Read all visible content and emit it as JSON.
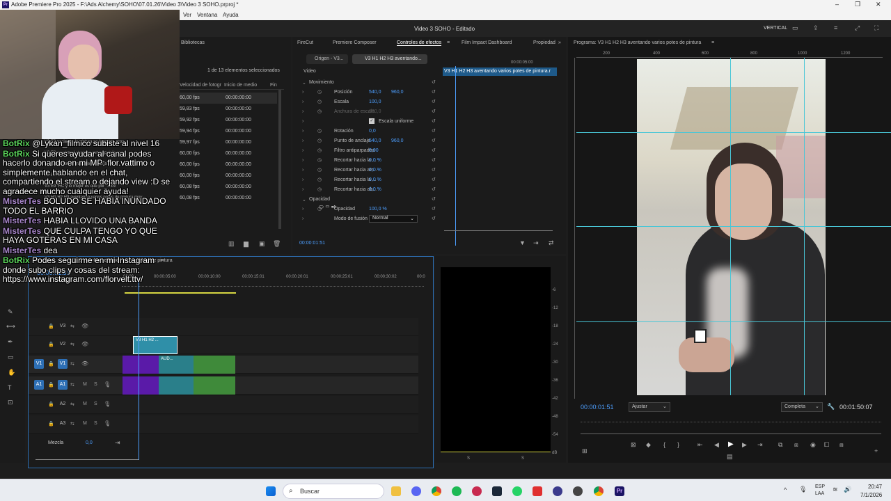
{
  "window": {
    "title": "Adobe Premiere Pro 2025 - F:\\Ads Alchemy\\SOHO\\07.01.26\\Video 3\\Video 3 SOHO.prproj *",
    "controls": [
      "–",
      "❐",
      "✕"
    ]
  },
  "menu": {
    "items": [
      "Ver",
      "Ventana",
      "Ayuda"
    ]
  },
  "appbar": {
    "project_title": "Video 3 SOHO - Editado",
    "vertical_label": "VERTICAL"
  },
  "project": {
    "tab": "Bibliotecas",
    "selection": "1 de 13 elementos seleccionados",
    "col_fps": "Velocidad de fotogr",
    "col_start": "Inicio de medio",
    "col_end": "Fin",
    "rows": [
      {
        "name": "",
        "fps": "60,00 fps",
        "start": "00:00:00:00"
      },
      {
        "name": "",
        "fps": "59,83 fps",
        "start": "00:00:00:00"
      },
      {
        "name": "",
        "fps": "59,92 fps",
        "start": "00:00:00:00"
      },
      {
        "name": "",
        "fps": "59,94 fps",
        "start": "00:00:00:00"
      },
      {
        "name": "V3 E3 vaciando la pintura en la paleta.mov",
        "fps": "59,97 fps",
        "start": "00:00:00:00"
      },
      {
        "name": "V3 E2 mostrando textura con espatula.mov",
        "fps": "60,00 fps",
        "start": "00:00:00:00"
      },
      {
        "name": "V3 E4 haciendo trazos en el lienzo.mov",
        "fps": "60,00 fps",
        "start": "00:00:00:00"
      },
      {
        "name": "V3 E5 ...",
        "fps": "60,00 fps",
        "start": "00:00:00:00"
      },
      {
        "name": "V3 E9_HC y lo mejor es que por_.mov",
        "fps": "60,08 fps",
        "start": "00:00:00:00"
      },
      {
        "name": "V3 H1 H2 H3 aventando varios potes de pintura.mov",
        "fps": "60,08 fps",
        "start": "00:00:00:00"
      }
    ]
  },
  "effects": {
    "tabs": [
      "FireCut",
      "Premiere Composer",
      "Controles de efectos",
      "Film Impact Dashboard",
      "Propiedad"
    ],
    "source_tab": "Origen - V3...",
    "clip_tab": "V3 H1 H2 H3 aventando...",
    "ruler_time": "00:00:05:00",
    "clip_label": "V3 H1 H2 H3 aventando varios potes de pintura.r",
    "section_video": "Video",
    "rows": [
      {
        "label": "Movimiento",
        "v1": "",
        "v2": ""
      },
      {
        "label": "Posición",
        "v1": "540,0",
        "v2": "960,0"
      },
      {
        "label": "Escala",
        "v1": "100,0",
        "v2": ""
      },
      {
        "label": "Anchura de escala",
        "v1": "100,0",
        "v2": ""
      },
      {
        "label": "Escala uniforme",
        "v1": "",
        "v2": ""
      },
      {
        "label": "Rotación",
        "v1": "0,0",
        "v2": ""
      },
      {
        "label": "Punto de anclaje",
        "v1": "540,0",
        "v2": "960,0"
      },
      {
        "label": "Filtro antiparpadeo",
        "v1": "0,00",
        "v2": ""
      },
      {
        "label": "Recortar hacia la ...",
        "v1": "0,0 %",
        "v2": ""
      },
      {
        "label": "Recortar hacia arr...",
        "v1": "0,0 %",
        "v2": ""
      },
      {
        "label": "Recortar hacia la ...",
        "v1": "0,0 %",
        "v2": ""
      },
      {
        "label": "Recortar hacia ab...",
        "v1": "0,0 %",
        "v2": ""
      },
      {
        "label": "Opacidad",
        "v1": "",
        "v2": ""
      },
      {
        "label": "Opacidad",
        "v1": "100,0 %",
        "v2": ""
      },
      {
        "label": "Modo de fusión",
        "v1": "Normal",
        "v2": ""
      }
    ],
    "timecode": "00:00:01:51"
  },
  "program": {
    "title": "Programa: V3 H1 H2 H3 aventando varios potes de pintura",
    "ruler": [
      "200",
      "400",
      "600",
      "800",
      "1000",
      "1200"
    ],
    "timecode": "00:00:01:51",
    "fit": "Ajustar",
    "quality": "Completa",
    "duration": "00:01:50:07"
  },
  "timeline": {
    "seq_name": "V3 H1 H2 H3 aventando varios potes de pintura",
    "timecode": "00:00:01:51",
    "ruler": [
      "00:00",
      "00:00:05:00",
      "00:00:10:00",
      "00:00:15:01",
      "00:00:20:01",
      "00:00:25:01",
      "00:00:30:02",
      "00:0"
    ],
    "tracks": [
      "V3",
      "V2",
      "V1",
      "A1",
      "A2",
      "A3"
    ],
    "mix_label": "Mezcla",
    "mix_value": "0,0",
    "clip_v2": "V3 H1 H2 ...",
    "clip_aud": "AUD..."
  },
  "meter": {
    "db": [
      "-6",
      "-12",
      "-18",
      "-24",
      "-30",
      "-36",
      "-42",
      "-48",
      "-54",
      "dB"
    ],
    "s1": "S",
    "s2": "S"
  },
  "chat": [
    {
      "user": "BotRix",
      "color": "#5cd65c",
      "msg": "@Lykan_filmico subiste al nivel 16"
    },
    {
      "user": "BotRix",
      "color": "#5cd65c",
      "msg": "Si queres ayudar al canal podes hacerlo donando en mi MP: flor.vattimo o simplemente hablando en el chat, compartiendo el stream o dejando view :D se agradece mucho cualquier ayuda!"
    },
    {
      "user": "MisterTes",
      "color": "#a785c9",
      "msg": "BOLUDO SE HABIA INUNDADO TODO EL BARRIO"
    },
    {
      "user": "MisterTes",
      "color": "#a785c9",
      "msg": "HABIA LLOVIDO UNA BANDA"
    },
    {
      "user": "MisterTes",
      "color": "#a785c9",
      "msg": "QUE CULPA TENGO YO QUE HAYA GOTERAS EN MI CASA"
    },
    {
      "user": "MisterTes",
      "color": "#a785c9",
      "msg": "dea"
    },
    {
      "user": "BotRix",
      "color": "#5cd65c",
      "msg": "Podes seguirme en mi Instagram donde subo clips y cosas del stream: https://www.instagram.com/florvelt.ttv/"
    }
  ],
  "taskbar": {
    "search": "Buscar",
    "lang1": "ESP",
    "lang2": "LAA",
    "time": "20:47",
    "date": "7/1/2026"
  }
}
